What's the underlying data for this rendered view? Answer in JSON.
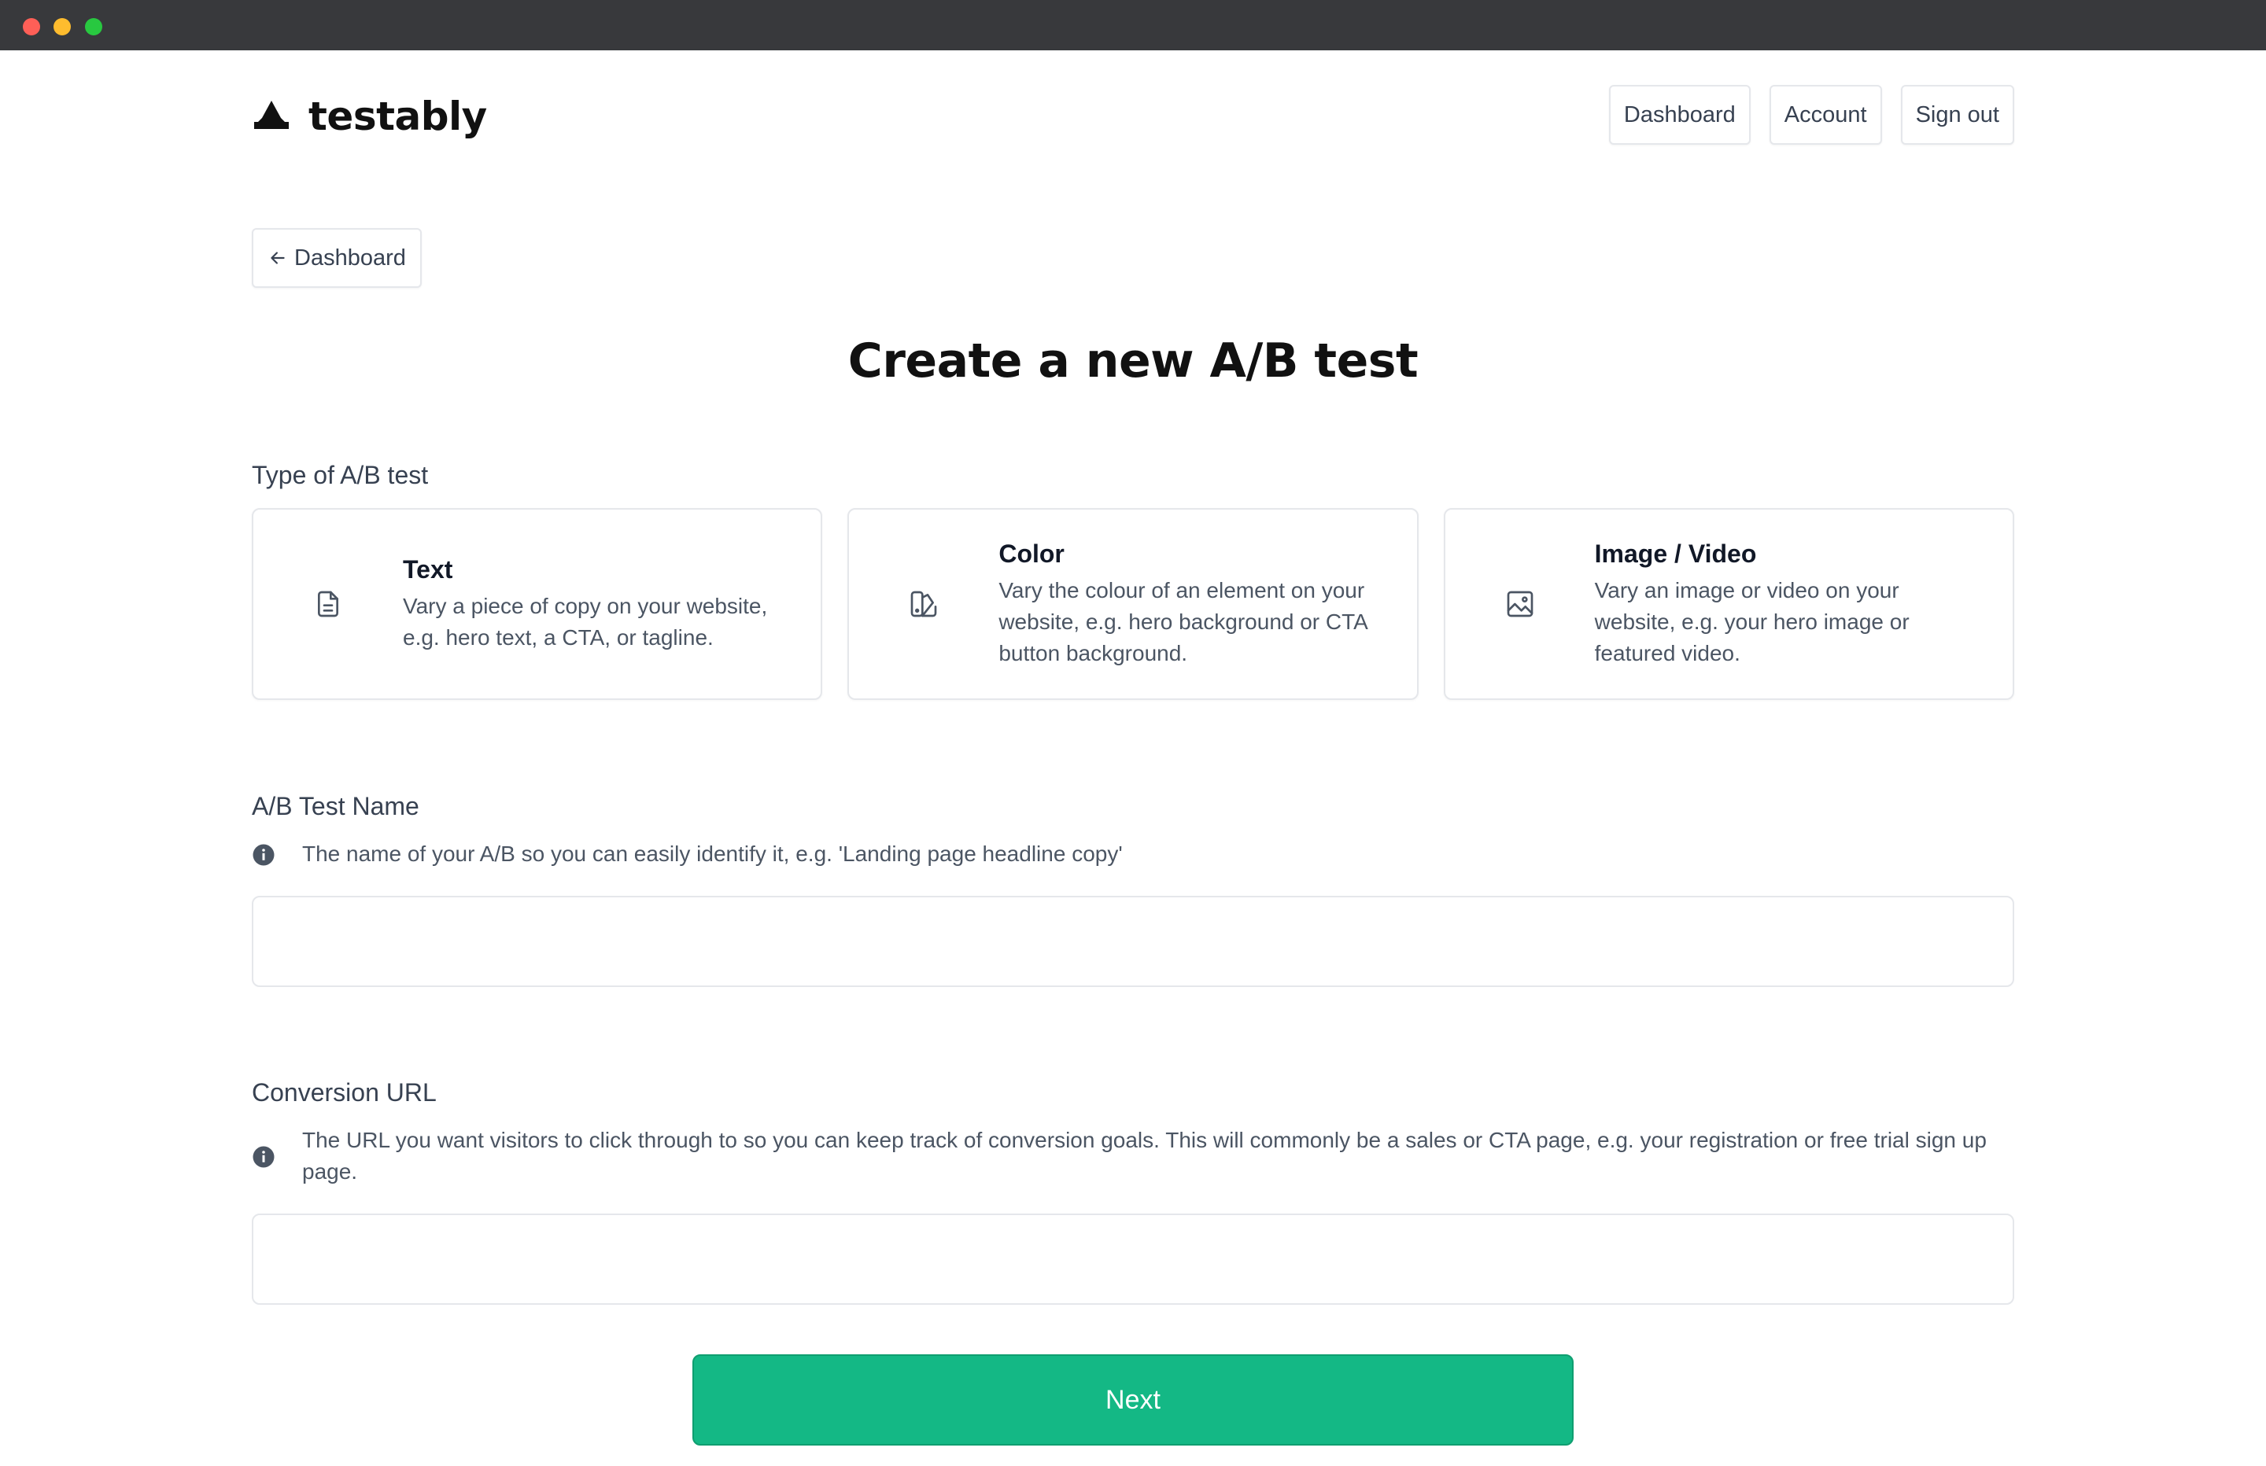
{
  "app": {
    "brand": "testably"
  },
  "header": {
    "nav": [
      {
        "label": "Dashboard"
      },
      {
        "label": "Account"
      },
      {
        "label": "Sign out"
      }
    ]
  },
  "back_button": {
    "label": "Dashboard"
  },
  "page_title": "Create a new A/B test",
  "test_type": {
    "label": "Type of A/B test",
    "options": [
      {
        "icon": "document-icon",
        "title": "Text",
        "description": "Vary a piece of copy on your website, e.g. hero text, a CTA, or tagline."
      },
      {
        "icon": "swatch-icon",
        "title": "Color",
        "description": "Vary the colour of an element on your website, e.g. hero background or CTA button background."
      },
      {
        "icon": "image-icon",
        "title": "Image / Video",
        "description": "Vary an image or video on your website, e.g. your hero image or featured video."
      }
    ]
  },
  "test_name": {
    "label": "A/B Test Name",
    "help": "The name of your A/B so you can easily identify it, e.g. 'Landing page headline copy'",
    "value": ""
  },
  "conversion_url": {
    "label": "Conversion URL",
    "help": "The URL you want visitors to click through to so you can keep track of conversion goals. This will commonly be a sales or CTA page, e.g. your registration or free trial sign up page.",
    "value": ""
  },
  "next_button": {
    "label": "Next"
  },
  "colors": {
    "accent": "#14b885",
    "titlebar": "#38393c"
  }
}
